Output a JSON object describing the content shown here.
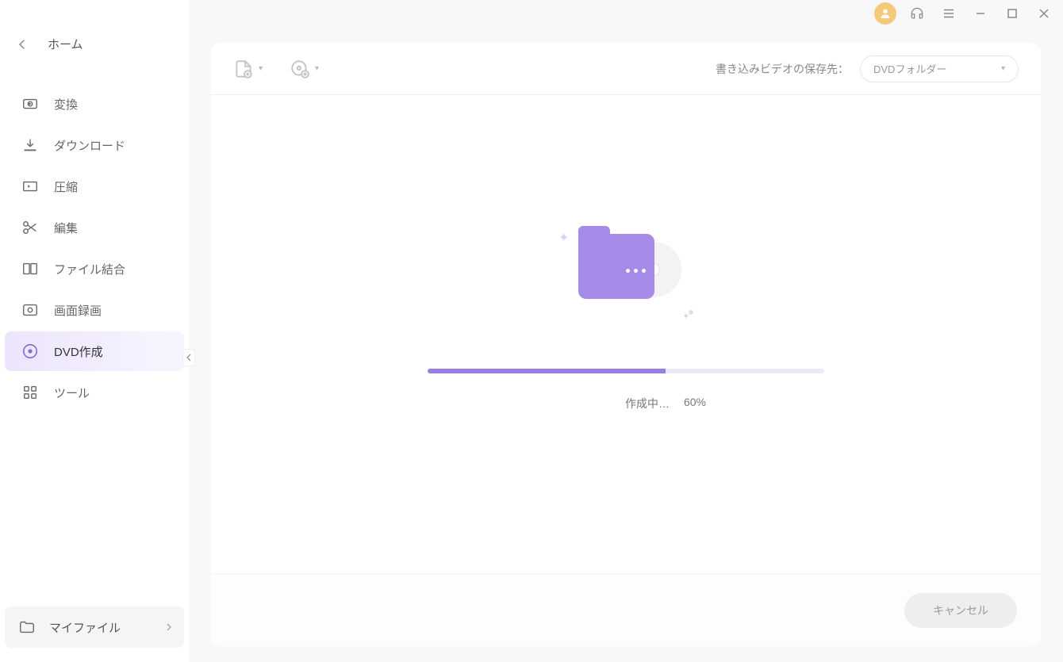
{
  "sidebar": {
    "home_label": "ホーム",
    "items": [
      {
        "label": "変換",
        "icon": "convert"
      },
      {
        "label": "ダウンロード",
        "icon": "download"
      },
      {
        "label": "圧縮",
        "icon": "compress"
      },
      {
        "label": "編集",
        "icon": "edit"
      },
      {
        "label": "ファイル結合",
        "icon": "merge"
      },
      {
        "label": "画面録画",
        "icon": "screen-record"
      },
      {
        "label": "DVD作成",
        "icon": "dvd",
        "active": true
      },
      {
        "label": "ツール",
        "icon": "tools"
      }
    ],
    "my_files_label": "マイファイル"
  },
  "toolbar": {
    "save_to_label": "書き込みビデオの保存先：",
    "save_to_value": "DVDフォルダー"
  },
  "progress": {
    "status_label": "作成中…",
    "percent_label": "60%",
    "percent_value": 60
  },
  "footer": {
    "cancel_label": "キャンセル"
  }
}
